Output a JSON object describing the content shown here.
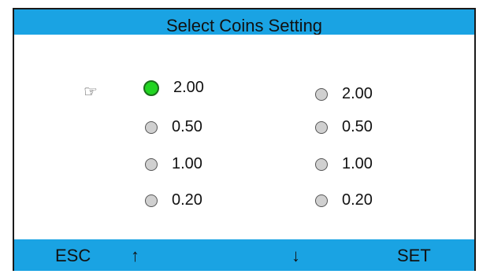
{
  "header": {
    "title": "Select Coins Setting"
  },
  "pointer_icon": "pointing-hand-icon",
  "left_column": [
    {
      "value": "2.00",
      "selected": true
    },
    {
      "value": "0.50",
      "selected": false
    },
    {
      "value": "1.00",
      "selected": false
    },
    {
      "value": "0.20",
      "selected": false
    }
  ],
  "right_column": [
    {
      "value": "2.00",
      "selected": false
    },
    {
      "value": "0.50",
      "selected": false
    },
    {
      "value": "1.00",
      "selected": false
    },
    {
      "value": "0.20",
      "selected": false
    }
  ],
  "footer": {
    "esc_label": "ESC",
    "up_label": "↑",
    "down_label": "↓",
    "set_label": "SET"
  },
  "colors": {
    "bar": "#1aa3e3",
    "selected_radio": "#22d422",
    "unselected_radio": "#d0d0d0"
  }
}
